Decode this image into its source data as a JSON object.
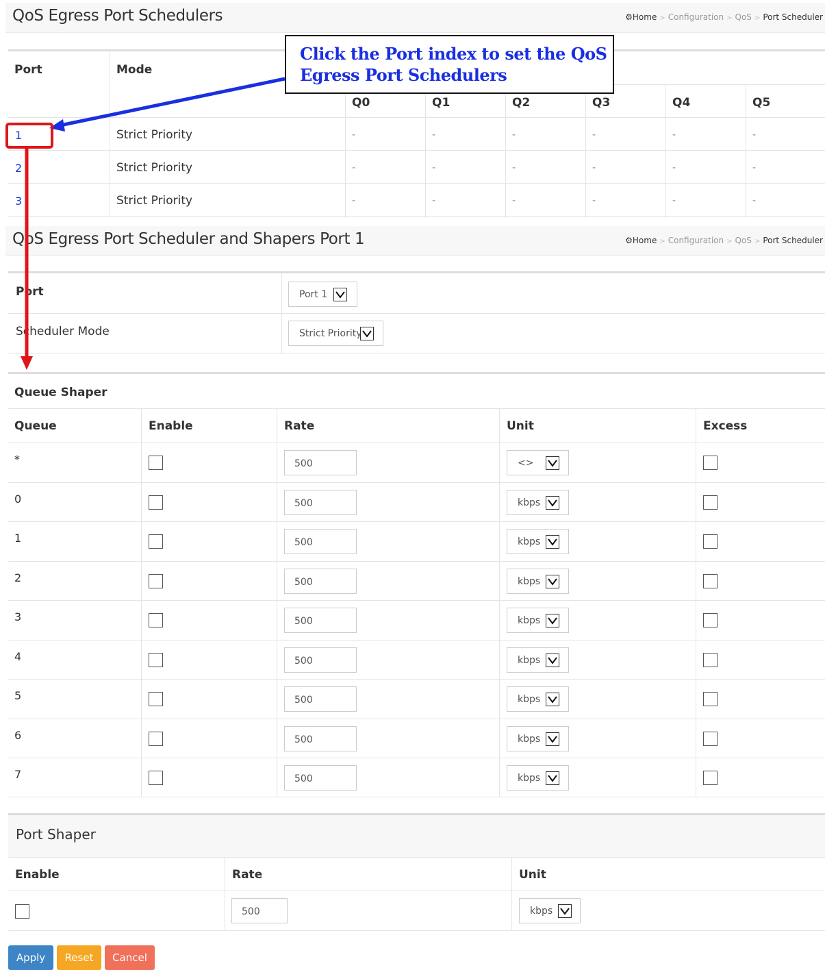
{
  "breadcrumb": {
    "home": "Home",
    "configuration": "Configuration",
    "qos": "QoS",
    "current": "Port Scheduler"
  },
  "schedulers": {
    "title": "QoS Egress Port Schedulers",
    "headers": {
      "port": "Port",
      "mode": "Mode",
      "q0": "Q0",
      "q1": "Q1",
      "q2": "Q2",
      "q3": "Q3",
      "q4": "Q4",
      "q5": "Q5"
    },
    "rows": [
      {
        "port": "1",
        "mode": "Strict Priority",
        "q": [
          "-",
          "-",
          "-",
          "-",
          "-",
          "-"
        ]
      },
      {
        "port": "2",
        "mode": "Strict Priority",
        "q": [
          "-",
          "-",
          "-",
          "-",
          "-",
          "-"
        ]
      },
      {
        "port": "3",
        "mode": "Strict Priority",
        "q": [
          "-",
          "-",
          "-",
          "-",
          "-",
          "-"
        ]
      }
    ]
  },
  "callout": {
    "line1": "Click the Port index to set the QoS",
    "line2": "Egress Port Schedulers"
  },
  "detail": {
    "title": "QoS Egress Port Scheduler and Shapers  Port 1",
    "port_label": "Port",
    "port_value": "Port 1",
    "mode_label": "Scheduler Mode",
    "mode_value": "Strict Priority"
  },
  "queue_shaper": {
    "title": "Queue Shaper",
    "headers": {
      "queue": "Queue",
      "enable": "Enable",
      "rate": "Rate",
      "unit": "Unit",
      "excess": "Excess"
    },
    "rows": [
      {
        "queue": "*",
        "rate": "500",
        "unit": "<>"
      },
      {
        "queue": "0",
        "rate": "500",
        "unit": "kbps"
      },
      {
        "queue": "1",
        "rate": "500",
        "unit": "kbps"
      },
      {
        "queue": "2",
        "rate": "500",
        "unit": "kbps"
      },
      {
        "queue": "3",
        "rate": "500",
        "unit": "kbps"
      },
      {
        "queue": "4",
        "rate": "500",
        "unit": "kbps"
      },
      {
        "queue": "5",
        "rate": "500",
        "unit": "kbps"
      },
      {
        "queue": "6",
        "rate": "500",
        "unit": "kbps"
      },
      {
        "queue": "7",
        "rate": "500",
        "unit": "kbps"
      }
    ]
  },
  "port_shaper": {
    "title": "Port Shaper",
    "headers": {
      "enable": "Enable",
      "rate": "Rate",
      "unit": "Unit"
    },
    "rate": "500",
    "unit": "kbps"
  },
  "buttons": {
    "apply": "Apply",
    "reset": "Reset",
    "cancel": "Cancel"
  },
  "colors": {
    "apply": "#3d85c6",
    "reset": "#f5a623",
    "cancel": "#f0705a",
    "arrow_blue": "#1a2fe0",
    "arrow_red": "#e0151b"
  }
}
